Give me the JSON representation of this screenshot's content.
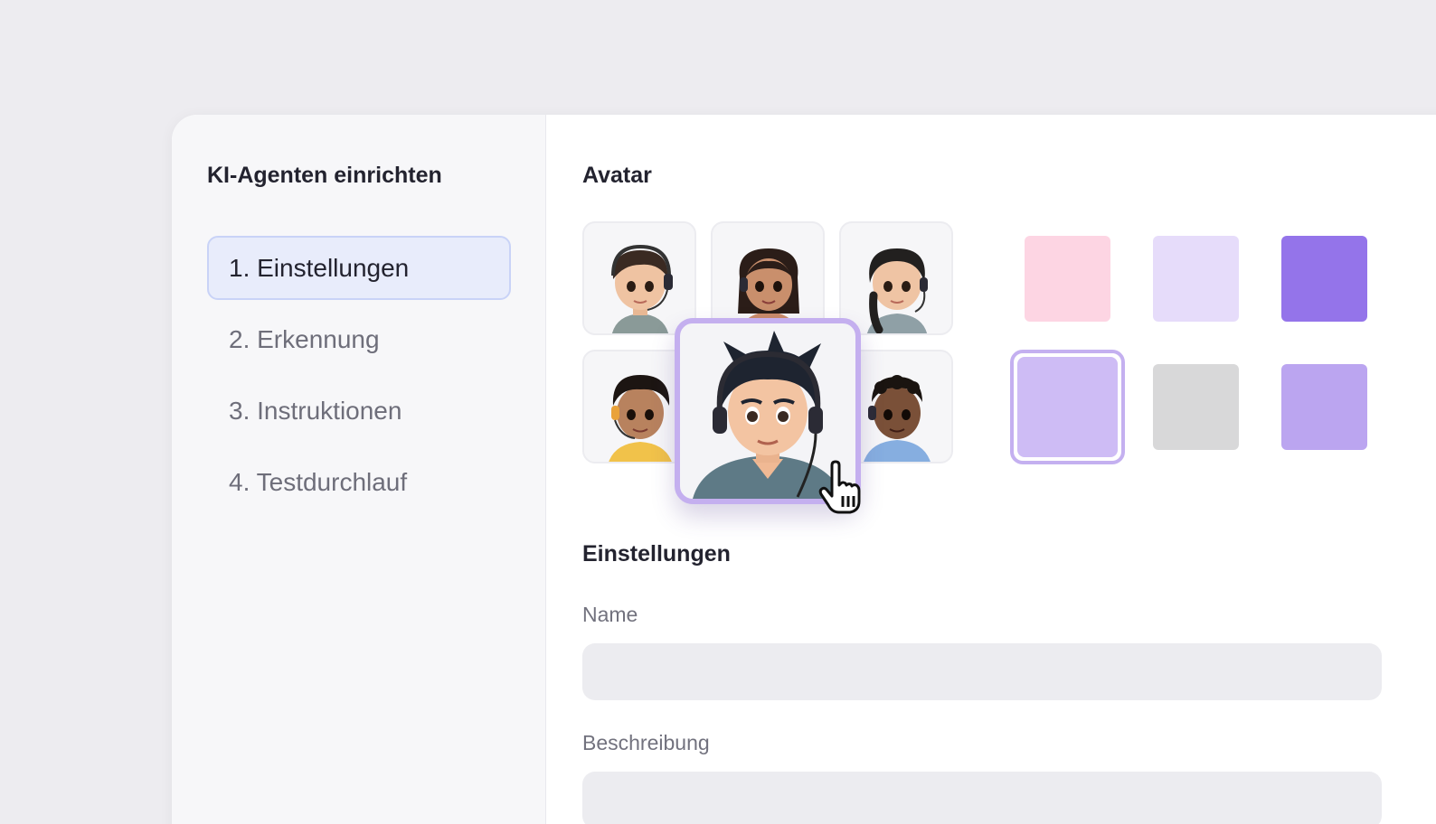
{
  "sidebar": {
    "title": "KI-Agenten einrichten",
    "steps": [
      {
        "label": "1. Einstellungen",
        "active": true
      },
      {
        "label": "2. Erkennung",
        "active": false
      },
      {
        "label": "3. Instruktionen",
        "active": false
      },
      {
        "label": "4. Testdurchlauf",
        "active": false
      }
    ]
  },
  "avatar_section": {
    "title": "Avatar",
    "avatars": [
      {
        "icon": "avatar-boy-headset-icon"
      },
      {
        "icon": "avatar-girl-headset-icon"
      },
      {
        "icon": "avatar-girl-braid-headset-icon"
      },
      {
        "icon": "avatar-boy-yellow-shirt-icon"
      },
      {
        "icon": "avatar-teen-headset-icon",
        "selected": true
      },
      {
        "icon": "avatar-boy-blue-hoodie-icon"
      }
    ],
    "colors": [
      "#fdd5e3",
      "#e6dcfa",
      "#9474ea",
      "#cebcf5",
      "#d8d8d9",
      "#bba5f0"
    ],
    "selected_color_index": 3
  },
  "settings_section": {
    "title": "Einstellungen",
    "name_label": "Name",
    "name_value": "",
    "description_label": "Beschreibung",
    "description_value": ""
  }
}
